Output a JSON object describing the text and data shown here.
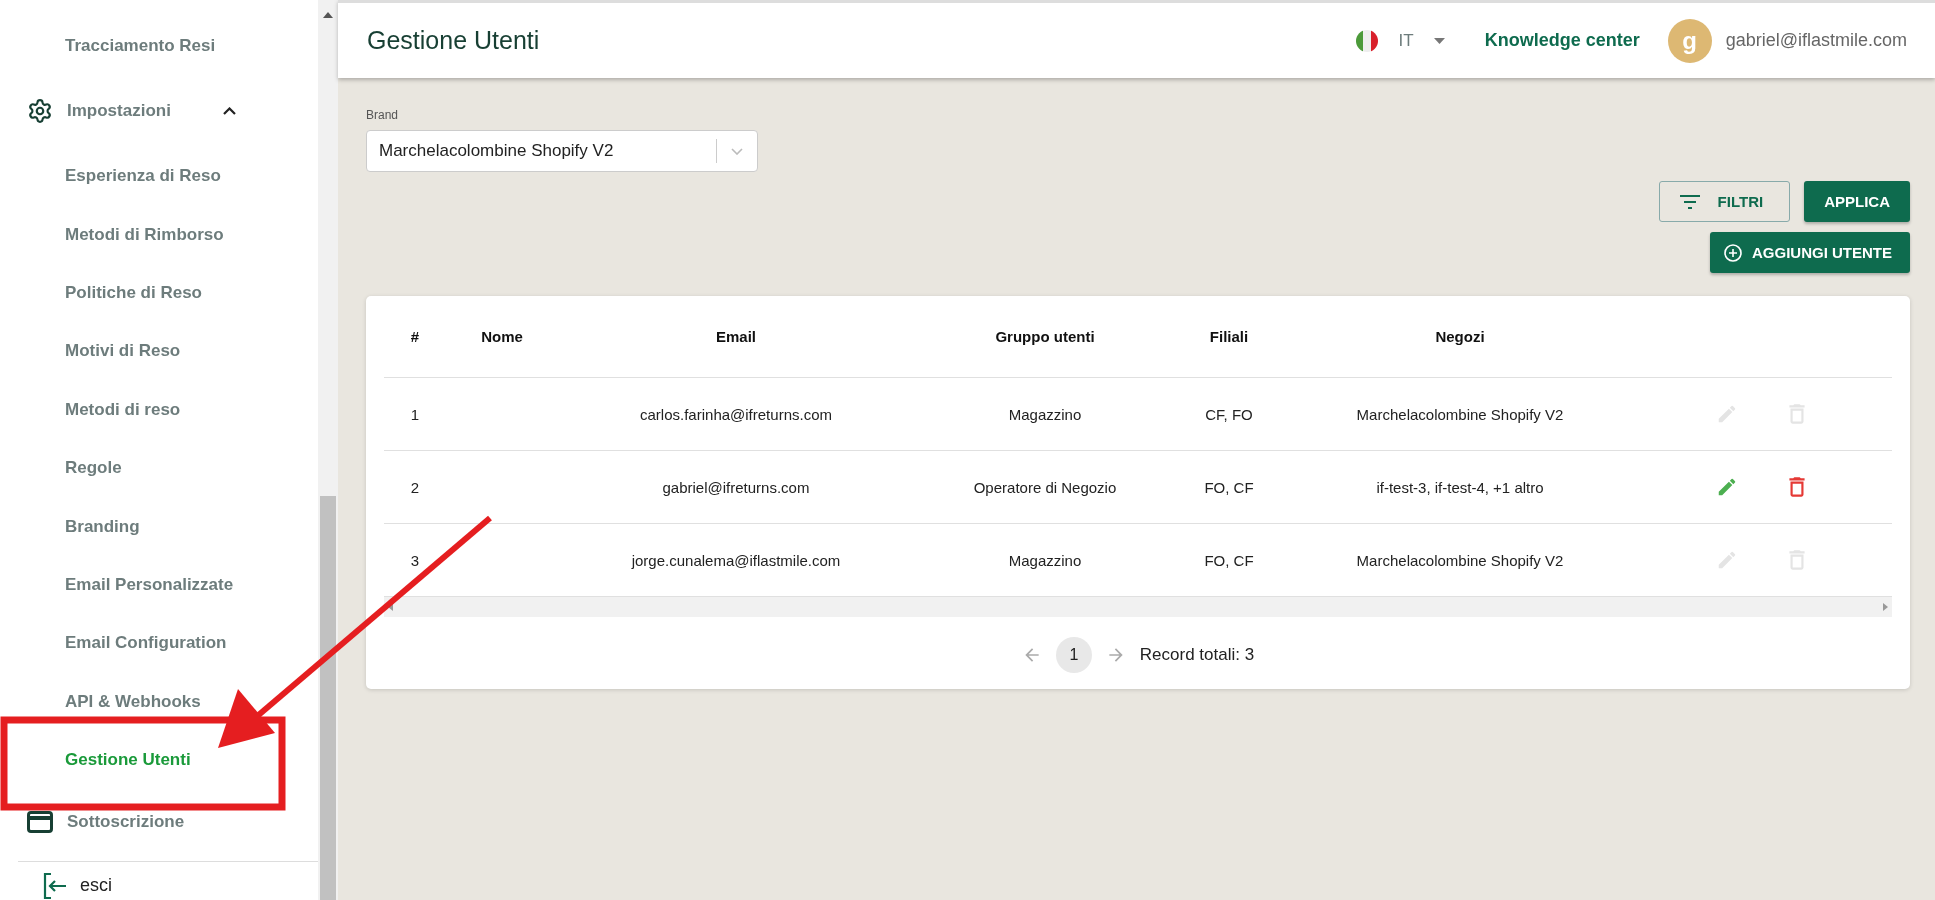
{
  "sidebar": {
    "items": [
      {
        "kind": "subitem",
        "label": "Tracciamento Resi",
        "selected": false
      },
      {
        "kind": "section",
        "label": "Impostazioni",
        "expanded": true,
        "selected": false,
        "children": [
          {
            "kind": "subitem",
            "label": "Esperienza di Reso",
            "selected": false
          },
          {
            "kind": "subitem",
            "label": "Metodi di Rimborso",
            "selected": false
          },
          {
            "kind": "subitem",
            "label": "Politiche di Reso",
            "selected": false
          },
          {
            "kind": "subitem",
            "label": "Motivi di Reso",
            "selected": false
          },
          {
            "kind": "subitem",
            "label": "Metodi di reso",
            "selected": false
          },
          {
            "kind": "subitem",
            "label": "Regole",
            "selected": false
          },
          {
            "kind": "subitem",
            "label": "Branding",
            "selected": false
          },
          {
            "kind": "subitem",
            "label": "Email Personalizzate",
            "selected": false
          },
          {
            "kind": "subitem",
            "label": "Email Configuration",
            "selected": false
          },
          {
            "kind": "subitem",
            "label": "API & Webhooks",
            "selected": false
          },
          {
            "kind": "subitem",
            "label": "Gestione Utenti",
            "selected": true
          }
        ]
      },
      {
        "kind": "link",
        "label": "Sottoscrizione",
        "selected": false
      }
    ],
    "logout": {
      "label": "esci"
    }
  },
  "header": {
    "title": "Gestione Utenti",
    "language": "IT",
    "knowledge_link": "Knowledge center",
    "user": {
      "initial": "g",
      "email": "gabriel@iflastmile.com"
    }
  },
  "filters": {
    "brand": {
      "label": "Brand",
      "value": "Marchelacolombine Shopify V2"
    },
    "filter_button": "FILTRI",
    "apply_button": "APPLICA",
    "add_button": "AGGIUNGI UTENTE"
  },
  "table": {
    "columns": [
      "#",
      "Nome",
      "Email",
      "Gruppo utenti",
      "Filiali",
      "Negozi"
    ],
    "rows": [
      {
        "number": "1",
        "email": "carlos.farinha@ifreturns.com",
        "group": "Magazzino",
        "branches": "CF, FO",
        "stores": "Marchelacolombine Shopify V2",
        "actions_enabled": false
      },
      {
        "number": "2",
        "email": "gabriel@ifreturns.com",
        "group": "Operatore di Negozio",
        "branches": "FO, CF",
        "stores": "if-test-3, if-test-4, +1 altro",
        "actions_enabled": true
      },
      {
        "number": "3",
        "email": "jorge.cunalema@iflastmile.com",
        "group": "Magazzino",
        "branches": "FO, CF",
        "stores": "Marchelacolombine Shopify V2",
        "actions_enabled": false
      }
    ],
    "pagination": {
      "pages": [
        {
          "label": "1",
          "selected": true
        }
      ],
      "total": "Record totali: 3"
    }
  }
}
